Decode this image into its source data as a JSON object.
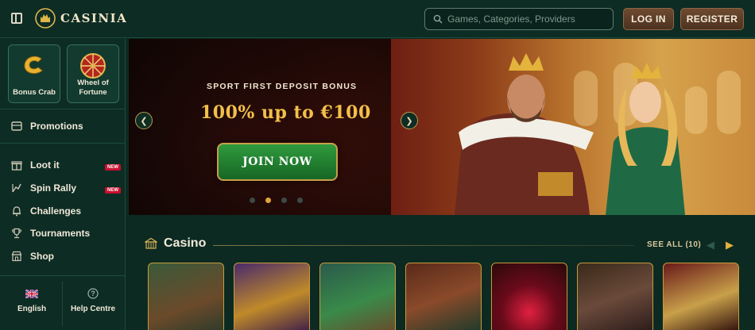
{
  "header": {
    "brand": "CASINIA",
    "search_placeholder": "Games, Categories, Providers",
    "login_label": "LOG IN",
    "register_label": "REGISTER"
  },
  "sidebar": {
    "tiles": [
      {
        "label": "Bonus Crab",
        "icon": "crab-c-icon"
      },
      {
        "label": "Wheel of Fortune",
        "icon": "wheel-icon"
      }
    ],
    "items": [
      {
        "label": "Promotions",
        "icon": "promotions-icon",
        "badge": ""
      },
      {
        "label": "Loot it",
        "icon": "gift-icon",
        "badge": "NEW"
      },
      {
        "label": "Spin Rally",
        "icon": "rally-icon",
        "badge": "NEW"
      },
      {
        "label": "Challenges",
        "icon": "bell-icon",
        "badge": ""
      },
      {
        "label": "Tournaments",
        "icon": "trophy-icon",
        "badge": ""
      },
      {
        "label": "Shop",
        "icon": "shop-icon",
        "badge": ""
      }
    ],
    "footer": [
      {
        "label": "English",
        "icon": "uk-flag-icon"
      },
      {
        "label": "Help Centre",
        "icon": "help-icon"
      }
    ]
  },
  "banner": {
    "subtitle": "SPORT FIRST DEPOSIT BONUS",
    "title": "100% up to €100",
    "cta": "JOIN NOW",
    "slides": 4,
    "active_slide": 2
  },
  "casino": {
    "title": "Casino",
    "see_all": "SEE ALL (10)",
    "game_count_visible": 7
  },
  "colors": {
    "background": "#0c2a22",
    "accent_gold": "#f2c04a",
    "button_brown": "#6e4a30",
    "cta_green": "#2f9a3e",
    "badge_red": "#c8102e"
  }
}
